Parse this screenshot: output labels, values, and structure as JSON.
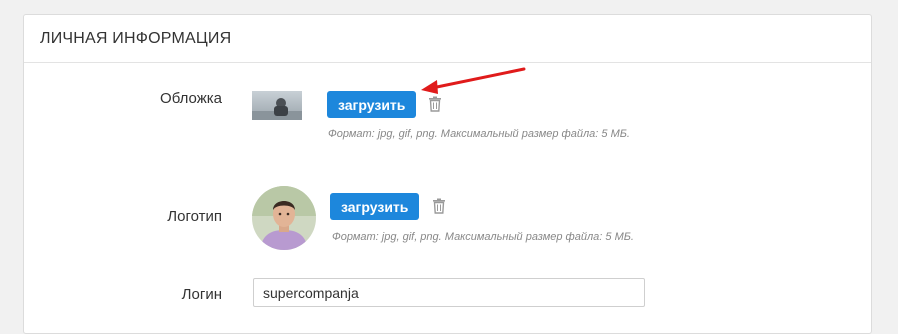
{
  "section": {
    "title": "ЛИЧНАЯ ИНФОРМАЦИЯ"
  },
  "cover": {
    "label": "Обложка",
    "upload_label": "загрузить",
    "hint": "Формат: jpg, gif, png. Максимальный размер файла: 5 МБ."
  },
  "logo": {
    "label": "Логотип",
    "upload_label": "загрузить",
    "hint": "Формат: jpg, gif, png. Максимальный размер файла: 5 МБ."
  },
  "login": {
    "label": "Логин",
    "value": "supercompanja"
  },
  "colors": {
    "accent": "#1d87dc",
    "annotation_arrow": "#e01b1b"
  },
  "icons": {
    "trash": "trash-icon",
    "annotation": "annotation-arrow"
  }
}
